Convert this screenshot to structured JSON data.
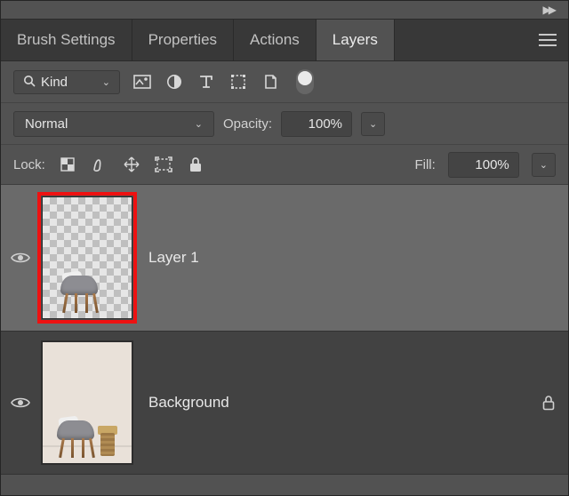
{
  "tabs": {
    "brush_settings": "Brush Settings",
    "properties": "Properties",
    "actions": "Actions",
    "layers": "Layers",
    "active": "layers"
  },
  "filter": {
    "kind_label": "Kind"
  },
  "blend": {
    "mode": "Normal",
    "opacity_label": "Opacity:",
    "opacity_value": "100%"
  },
  "lock": {
    "label": "Lock:",
    "fill_label": "Fill:",
    "fill_value": "100%"
  },
  "layers": [
    {
      "name": "Layer 1",
      "visible": true,
      "selected": true,
      "locked": false,
      "thumb": "transparent-chair"
    },
    {
      "name": "Background",
      "visible": true,
      "selected": false,
      "locked": true,
      "thumb": "room-chair"
    }
  ],
  "colors": {
    "panel_bg": "#525252",
    "tab_bg": "#383838",
    "row_selected": "#6a6a6a",
    "highlight": "#e11"
  }
}
